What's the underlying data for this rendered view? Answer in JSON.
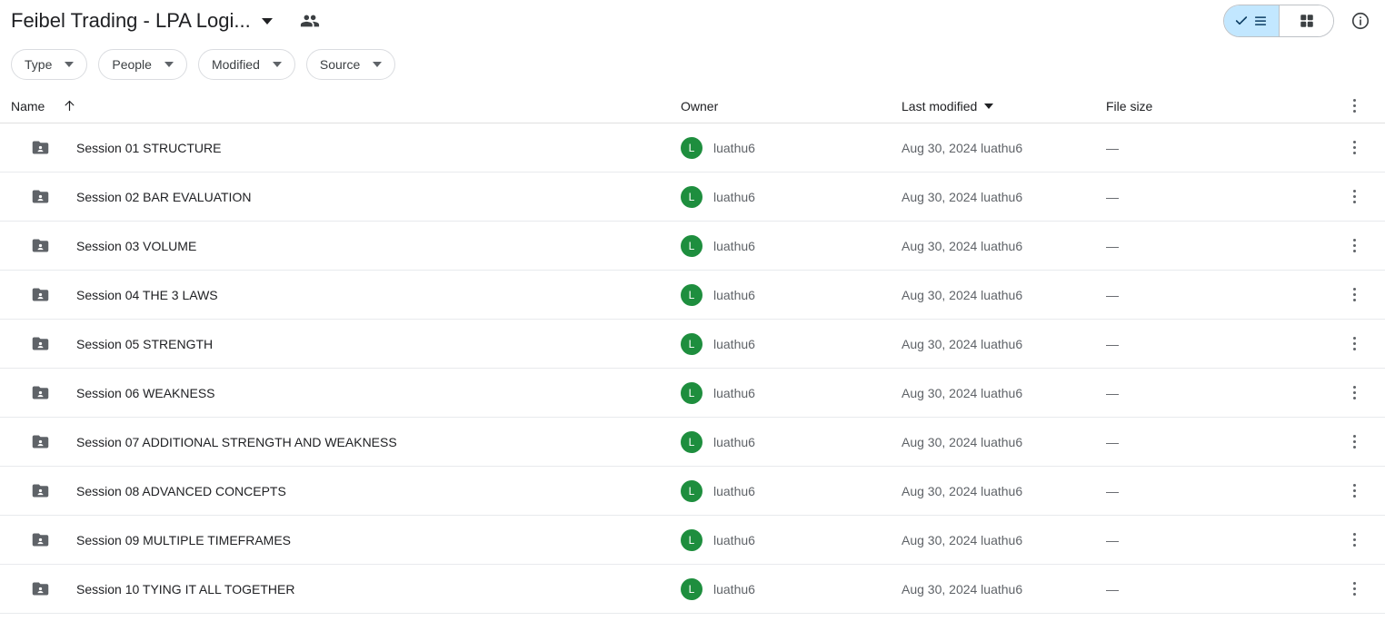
{
  "header": {
    "title": "Feibel Trading - LPA Logi...",
    "title_caret_icon": "chevron-down-icon",
    "shared_people_icon": "people-icon",
    "view_toggle": {
      "list_label": "list-view",
      "grid_label": "grid-view",
      "active": "list-view",
      "active_color": "#c2e7ff"
    },
    "info_icon": "info-circle-icon"
  },
  "filters": [
    {
      "label": "Type"
    },
    {
      "label": "People"
    },
    {
      "label": "Modified"
    },
    {
      "label": "Source"
    }
  ],
  "table": {
    "columns": {
      "name": "Name",
      "owner": "Owner",
      "last_modified": "Last modified",
      "file_size": "File size"
    },
    "sort": {
      "column": "Name",
      "direction_icon": "arrow-up-icon"
    },
    "more_options_icon": "kebab-menu-icon",
    "rows": [
      {
        "icon": "shared-folder-icon",
        "name": "Session 01 STRUCTURE",
        "owner_initial": "L",
        "owner": "luathu6",
        "modified": "Aug 30, 2024 luathu6",
        "size": "—"
      },
      {
        "icon": "shared-folder-icon",
        "name": "Session 02 BAR EVALUATION",
        "owner_initial": "L",
        "owner": "luathu6",
        "modified": "Aug 30, 2024 luathu6",
        "size": "—"
      },
      {
        "icon": "shared-folder-icon",
        "name": "Session 03 VOLUME",
        "owner_initial": "L",
        "owner": "luathu6",
        "modified": "Aug 30, 2024 luathu6",
        "size": "—"
      },
      {
        "icon": "shared-folder-icon",
        "name": "Session 04 THE 3 LAWS",
        "owner_initial": "L",
        "owner": "luathu6",
        "modified": "Aug 30, 2024 luathu6",
        "size": "—"
      },
      {
        "icon": "shared-folder-icon",
        "name": "Session 05 STRENGTH",
        "owner_initial": "L",
        "owner": "luathu6",
        "modified": "Aug 30, 2024 luathu6",
        "size": "—"
      },
      {
        "icon": "shared-folder-icon",
        "name": "Session 06 WEAKNESS",
        "owner_initial": "L",
        "owner": "luathu6",
        "modified": "Aug 30, 2024 luathu6",
        "size": "—"
      },
      {
        "icon": "shared-folder-icon",
        "name": "Session 07 ADDITIONAL STRENGTH AND WEAKNESS",
        "owner_initial": "L",
        "owner": "luathu6",
        "modified": "Aug 30, 2024 luathu6",
        "size": "—"
      },
      {
        "icon": "shared-folder-icon",
        "name": "Session 08 ADVANCED CONCEPTS",
        "owner_initial": "L",
        "owner": "luathu6",
        "modified": "Aug 30, 2024 luathu6",
        "size": "—"
      },
      {
        "icon": "shared-folder-icon",
        "name": "Session 09 MULTIPLE TIMEFRAMES",
        "owner_initial": "L",
        "owner": "luathu6",
        "modified": "Aug 30, 2024 luathu6",
        "size": "—"
      },
      {
        "icon": "shared-folder-icon",
        "name": "Session 10 TYING IT ALL TOGETHER",
        "owner_initial": "L",
        "owner": "luathu6",
        "modified": "Aug 30, 2024 luathu6",
        "size": "—"
      }
    ]
  },
  "colors": {
    "avatar_green": "#1e8e3e",
    "folder_gray": "#5f6368",
    "accent_blue": "#c2e7ff",
    "text_primary": "#202124",
    "text_secondary": "#5f6368"
  }
}
